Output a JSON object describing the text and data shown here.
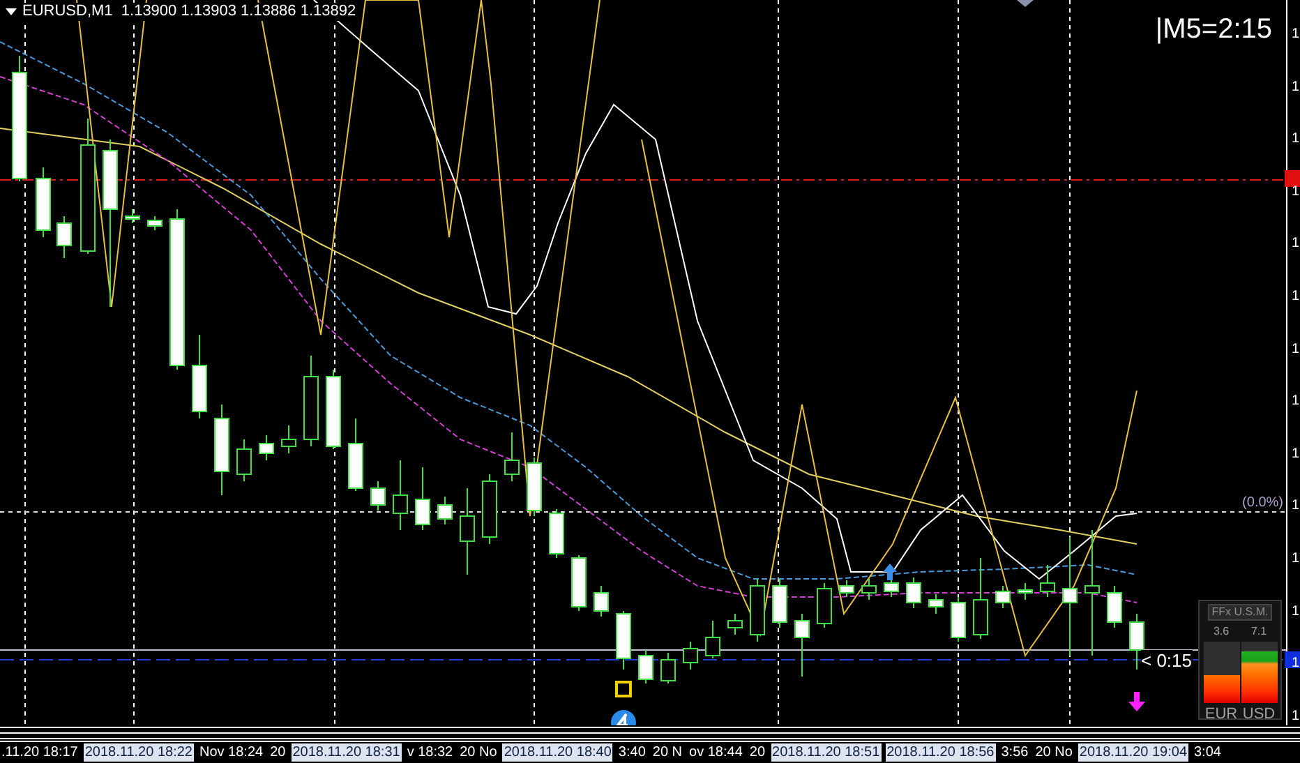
{
  "chart": {
    "title": "EURUSD,M1  1.13900 1.13903 1.13886 1.13892",
    "timer": "|M5=2:15",
    "fib_label": "(0.0%)",
    "bar_countdown": "< 0:15"
  },
  "price_axis": {
    "labels": [
      "1",
      "1",
      "1",
      "1",
      "1",
      "1",
      "1",
      "1",
      "1",
      "1",
      "1",
      "1",
      "1",
      "1"
    ]
  },
  "strength_widget": {
    "title": "FFx U.S.M.",
    "currencies": [
      {
        "name": "EUR",
        "value": "3.6",
        "level": 0.45
      },
      {
        "name": "USD",
        "value": "7.1",
        "level": 0.85
      }
    ]
  },
  "time_axis": {
    "labels": [
      {
        "text": ".11.20 18:17",
        "highlighted": false
      },
      {
        "text": "2018.11.20 18:22",
        "highlighted": true
      },
      {
        "text": "Nov 18:24",
        "highlighted": false
      },
      {
        "text": "20",
        "highlighted": false
      },
      {
        "text": "2018.11.20 18:31",
        "highlighted": true
      },
      {
        "text": "v 18:32",
        "highlighted": false
      },
      {
        "text": "20 No",
        "highlighted": false
      },
      {
        "text": "2018.11.20 18:40",
        "highlighted": true
      },
      {
        "text": "3:40",
        "highlighted": false
      },
      {
        "text": "20 N",
        "highlighted": false
      },
      {
        "text": "ov 18:44",
        "highlighted": false
      },
      {
        "text": "20",
        "highlighted": false
      },
      {
        "text": "2018.11.20 18:51",
        "highlighted": true
      },
      {
        "text": "2018.11.20 18:56",
        "highlighted": true
      },
      {
        "text": "3:56",
        "highlighted": false
      },
      {
        "text": "20 No",
        "highlighted": false
      },
      {
        "text": "2018.11.20 19:04",
        "highlighted": true
      },
      {
        "text": "3:04",
        "highlighted": false
      }
    ]
  }
}
